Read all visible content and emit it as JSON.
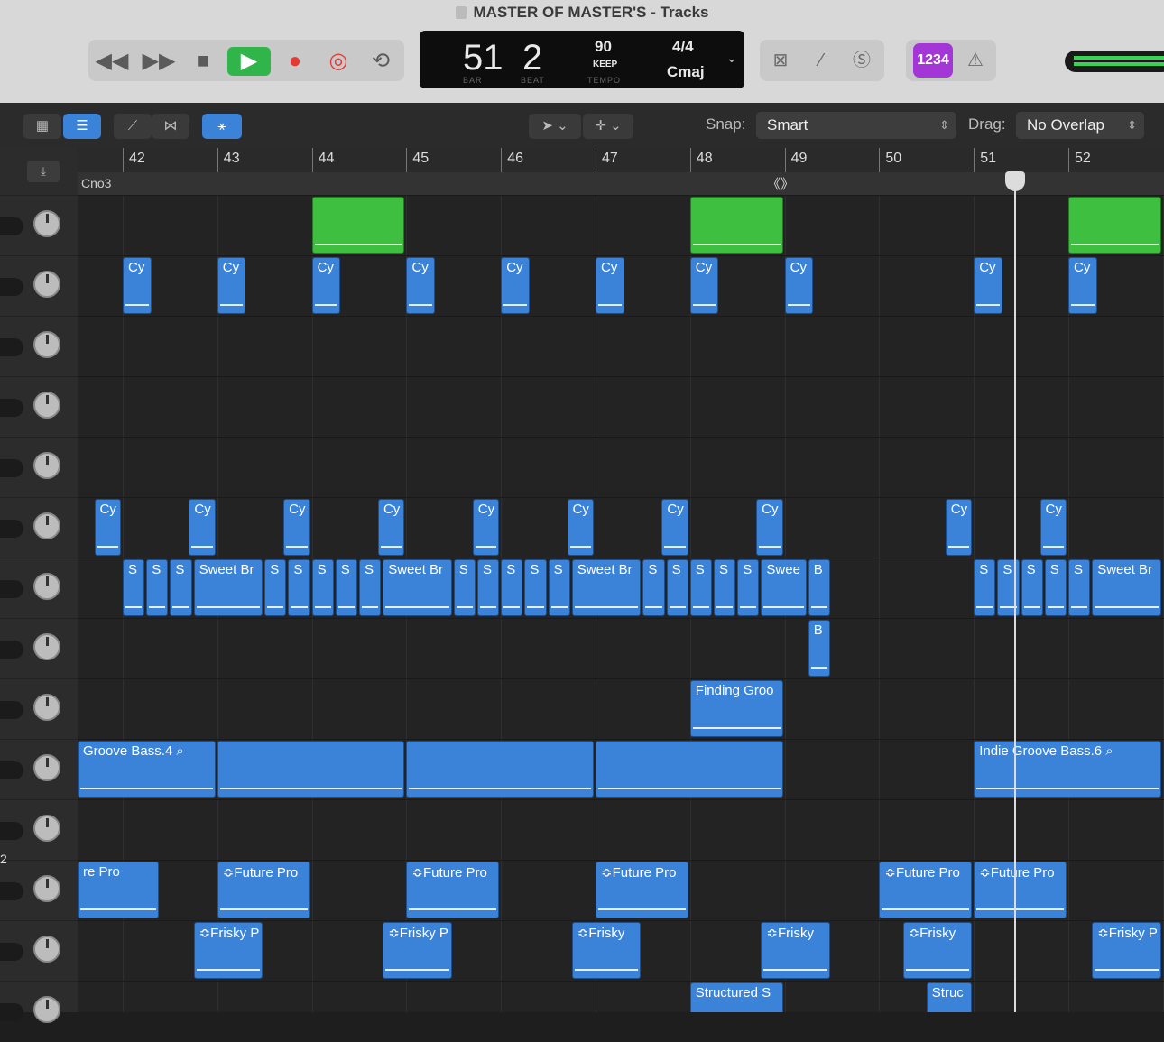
{
  "window": {
    "title": "MASTER OF MASTER'S - Tracks"
  },
  "transport": {
    "rewind": "◀◀",
    "forward": "▶▶",
    "stop": "■",
    "play": "▶",
    "record": "●",
    "replace": "◎",
    "cycle": "⟲"
  },
  "lcd": {
    "bar": "51",
    "beat": "2",
    "bar_label": "BAR",
    "beat_label": "BEAT",
    "tempo": "90",
    "keep": "KEEP",
    "tempo_label": "TEMPO",
    "signature": "4/4",
    "key": "Cmaj"
  },
  "count_in": "1234",
  "toolbar": {
    "snap_label": "Snap:",
    "snap_value": "Smart",
    "drag_label": "Drag:",
    "drag_value": "No Overlap"
  },
  "ruler": {
    "bars": [
      "42",
      "43",
      "44",
      "45",
      "46",
      "47",
      "48",
      "49",
      "50",
      "51",
      "52"
    ]
  },
  "marker": {
    "label": "Cno3"
  },
  "row_number": "2",
  "regions": [
    {
      "row": 0,
      "bar": 44,
      "len": 1,
      "label": "",
      "green": true
    },
    {
      "row": 0,
      "bar": 48,
      "len": 1,
      "label": "",
      "green": true
    },
    {
      "row": 0,
      "bar": 52,
      "len": 1,
      "label": "",
      "green": true
    },
    {
      "row": 1,
      "bar": 42,
      "len": 0.32,
      "label": "Cy"
    },
    {
      "row": 1,
      "bar": 43,
      "len": 0.32,
      "label": "Cy"
    },
    {
      "row": 1,
      "bar": 44,
      "len": 0.32,
      "label": "Cy"
    },
    {
      "row": 1,
      "bar": 45,
      "len": 0.32,
      "label": "Cy"
    },
    {
      "row": 1,
      "bar": 46,
      "len": 0.32,
      "label": "Cy"
    },
    {
      "row": 1,
      "bar": 47,
      "len": 0.32,
      "label": "Cy"
    },
    {
      "row": 1,
      "bar": 48,
      "len": 0.32,
      "label": "Cy"
    },
    {
      "row": 1,
      "bar": 49,
      "len": 0.32,
      "label": "Cy"
    },
    {
      "row": 1,
      "bar": 51,
      "len": 0.32,
      "label": "Cy"
    },
    {
      "row": 1,
      "bar": 52,
      "len": 0.32,
      "label": "Cy"
    },
    {
      "row": 5,
      "bar": 41.7,
      "len": 0.3,
      "label": "Cy"
    },
    {
      "row": 5,
      "bar": 42.7,
      "len": 0.3,
      "label": "Cy"
    },
    {
      "row": 5,
      "bar": 43.7,
      "len": 0.3,
      "label": "Cy"
    },
    {
      "row": 5,
      "bar": 44.7,
      "len": 0.3,
      "label": "Cy"
    },
    {
      "row": 5,
      "bar": 45.7,
      "len": 0.3,
      "label": "Cy"
    },
    {
      "row": 5,
      "bar": 46.7,
      "len": 0.3,
      "label": "Cy"
    },
    {
      "row": 5,
      "bar": 47.7,
      "len": 0.3,
      "label": "Cy"
    },
    {
      "row": 5,
      "bar": 48.7,
      "len": 0.3,
      "label": "Cy"
    },
    {
      "row": 5,
      "bar": 50.7,
      "len": 0.3,
      "label": "Cy"
    },
    {
      "row": 5,
      "bar": 51.7,
      "len": 0.3,
      "label": "Cy"
    },
    {
      "row": 6,
      "bar": 42.0,
      "len": 0.25,
      "label": "S"
    },
    {
      "row": 6,
      "bar": 42.25,
      "len": 0.25,
      "label": "S"
    },
    {
      "row": 6,
      "bar": 42.5,
      "len": 0.25,
      "label": "S"
    },
    {
      "row": 6,
      "bar": 42.75,
      "len": 0.75,
      "label": "Sweet Br"
    },
    {
      "row": 6,
      "bar": 43.5,
      "len": 0.25,
      "label": "S"
    },
    {
      "row": 6,
      "bar": 43.75,
      "len": 0.25,
      "label": "S"
    },
    {
      "row": 6,
      "bar": 44.0,
      "len": 0.25,
      "label": "S"
    },
    {
      "row": 6,
      "bar": 44.25,
      "len": 0.25,
      "label": "S"
    },
    {
      "row": 6,
      "bar": 44.5,
      "len": 0.25,
      "label": "S"
    },
    {
      "row": 6,
      "bar": 44.75,
      "len": 0.75,
      "label": "Sweet Br"
    },
    {
      "row": 6,
      "bar": 45.5,
      "len": 0.25,
      "label": "S"
    },
    {
      "row": 6,
      "bar": 45.75,
      "len": 0.25,
      "label": "S"
    },
    {
      "row": 6,
      "bar": 46.0,
      "len": 0.25,
      "label": "S"
    },
    {
      "row": 6,
      "bar": 46.25,
      "len": 0.25,
      "label": "S"
    },
    {
      "row": 6,
      "bar": 46.5,
      "len": 0.25,
      "label": "S"
    },
    {
      "row": 6,
      "bar": 46.75,
      "len": 0.75,
      "label": "Sweet Br"
    },
    {
      "row": 6,
      "bar": 47.5,
      "len": 0.25,
      "label": "S"
    },
    {
      "row": 6,
      "bar": 47.75,
      "len": 0.25,
      "label": "S"
    },
    {
      "row": 6,
      "bar": 48.0,
      "len": 0.25,
      "label": "S"
    },
    {
      "row": 6,
      "bar": 48.25,
      "len": 0.25,
      "label": "S"
    },
    {
      "row": 6,
      "bar": 48.5,
      "len": 0.25,
      "label": "S"
    },
    {
      "row": 6,
      "bar": 48.75,
      "len": 0.5,
      "label": "Swee"
    },
    {
      "row": 6,
      "bar": 49.25,
      "len": 0.25,
      "label": "B"
    },
    {
      "row": 6,
      "bar": 51.0,
      "len": 0.25,
      "label": "S"
    },
    {
      "row": 6,
      "bar": 51.25,
      "len": 0.25,
      "label": "S"
    },
    {
      "row": 6,
      "bar": 51.5,
      "len": 0.25,
      "label": "S"
    },
    {
      "row": 6,
      "bar": 51.75,
      "len": 0.25,
      "label": "S"
    },
    {
      "row": 6,
      "bar": 52.0,
      "len": 0.25,
      "label": "S"
    },
    {
      "row": 6,
      "bar": 52.25,
      "len": 0.75,
      "label": "Sweet Br"
    },
    {
      "row": 7,
      "bar": 49.25,
      "len": 0.25,
      "label": "B"
    },
    {
      "row": 8,
      "bar": 48.0,
      "len": 1.0,
      "label": "Finding Groo"
    },
    {
      "row": 9,
      "bar": 41.5,
      "len": 1.5,
      "label": "Groove Bass.4 ⌕"
    },
    {
      "row": 9,
      "bar": 43.0,
      "len": 2.0,
      "label": ""
    },
    {
      "row": 9,
      "bar": 45.0,
      "len": 2.0,
      "label": ""
    },
    {
      "row": 9,
      "bar": 47.0,
      "len": 2.0,
      "label": ""
    },
    {
      "row": 9,
      "bar": 51.0,
      "len": 2.0,
      "label": "Indie Groove Bass.6 ⌕"
    },
    {
      "row": 11,
      "bar": 41.5,
      "len": 0.9,
      "label": "re Pro"
    },
    {
      "row": 11,
      "bar": 43.0,
      "len": 1.0,
      "label": "≎Future Pro"
    },
    {
      "row": 11,
      "bar": 45.0,
      "len": 1.0,
      "label": "≎Future Pro"
    },
    {
      "row": 11,
      "bar": 47.0,
      "len": 1.0,
      "label": "≎Future Pro"
    },
    {
      "row": 11,
      "bar": 50.0,
      "len": 1.0,
      "label": "≎Future Pro"
    },
    {
      "row": 11,
      "bar": 51.0,
      "len": 1.0,
      "label": "≎Future Pro"
    },
    {
      "row": 12,
      "bar": 42.75,
      "len": 0.75,
      "label": "≎Frisky P"
    },
    {
      "row": 12,
      "bar": 44.75,
      "len": 0.75,
      "label": "≎Frisky P"
    },
    {
      "row": 12,
      "bar": 46.75,
      "len": 0.75,
      "label": "≎Frisky"
    },
    {
      "row": 12,
      "bar": 48.75,
      "len": 0.75,
      "label": "≎Frisky"
    },
    {
      "row": 12,
      "bar": 50.25,
      "len": 0.75,
      "label": "≎Frisky"
    },
    {
      "row": 12,
      "bar": 52.25,
      "len": 0.75,
      "label": "≎Frisky P"
    },
    {
      "row": 13,
      "bar": 48.0,
      "len": 1.0,
      "label": "Structured S"
    },
    {
      "row": 13,
      "bar": 50.5,
      "len": 0.5,
      "label": "Struc"
    }
  ]
}
